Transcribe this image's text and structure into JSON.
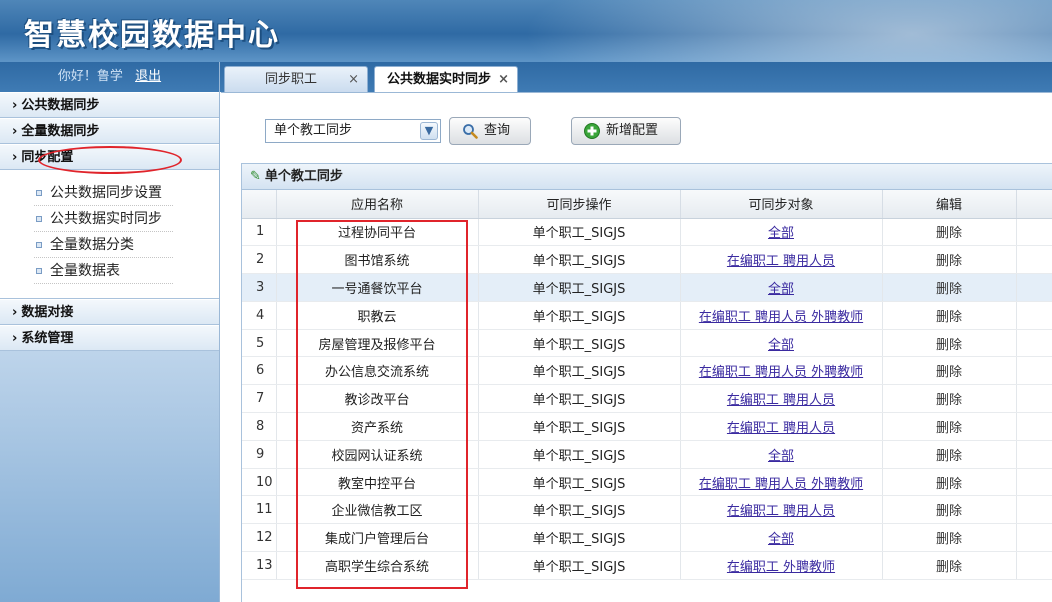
{
  "header": {
    "logo_text": "智慧校园数据中心"
  },
  "user": {
    "greeting": "你好！鲁学",
    "logout": "退出"
  },
  "sidebar": {
    "sections": [
      {
        "label": "公共数据同步"
      },
      {
        "label": "全量数据同步"
      },
      {
        "label": "同步配置"
      },
      {
        "label": "数据对接"
      },
      {
        "label": "系统管理"
      }
    ],
    "sub_items": [
      {
        "label": "公共数据同步设置"
      },
      {
        "label": "公共数据实时同步"
      },
      {
        "label": "全量数据分类"
      },
      {
        "label": "全量数据表"
      }
    ]
  },
  "tabs": [
    {
      "label": "同步职工",
      "close": "×"
    },
    {
      "label": "公共数据实时同步",
      "close": "×"
    }
  ],
  "toolbar": {
    "select_value": "单个教工同步",
    "query_label": "查询",
    "add_label": "新增配置"
  },
  "panel": {
    "title": "单个教工同步"
  },
  "table": {
    "columns": [
      "应用名称",
      "可同步操作",
      "可同步对象",
      "编辑"
    ],
    "rows": [
      {
        "no": "1",
        "app": "过程协同平台",
        "op": "单个职工_SIGJS",
        "targets": "全部",
        "edit": "删除"
      },
      {
        "no": "2",
        "app": "图书馆系统",
        "op": "单个职工_SIGJS",
        "targets": "在编职工 聘用人员",
        "edit": "删除"
      },
      {
        "no": "3",
        "app": "一号通餐饮平台",
        "op": "单个职工_SIGJS",
        "targets": "全部",
        "edit": "删除"
      },
      {
        "no": "4",
        "app": "职教云",
        "op": "单个职工_SIGJS",
        "targets": "在编职工 聘用人员 外聘教师",
        "edit": "删除"
      },
      {
        "no": "5",
        "app": "房屋管理及报修平台",
        "op": "单个职工_SIGJS",
        "targets": "全部",
        "edit": "删除"
      },
      {
        "no": "6",
        "app": "办公信息交流系统",
        "op": "单个职工_SIGJS",
        "targets": "在编职工 聘用人员 外聘教师",
        "edit": "删除"
      },
      {
        "no": "7",
        "app": "教诊改平台",
        "op": "单个职工_SIGJS",
        "targets": "在编职工 聘用人员",
        "edit": "删除"
      },
      {
        "no": "8",
        "app": "资产系统",
        "op": "单个职工_SIGJS",
        "targets": "在编职工 聘用人员",
        "edit": "删除"
      },
      {
        "no": "9",
        "app": "校园网认证系统",
        "op": "单个职工_SIGJS",
        "targets": "全部",
        "edit": "删除"
      },
      {
        "no": "10",
        "app": "教室中控平台",
        "op": "单个职工_SIGJS",
        "targets": "在编职工 聘用人员 外聘教师",
        "edit": "删除"
      },
      {
        "no": "11",
        "app": "企业微信教工区",
        "op": "单个职工_SIGJS",
        "targets": "在编职工 聘用人员",
        "edit": "删除"
      },
      {
        "no": "12",
        "app": "集成门户管理后台",
        "op": "单个职工_SIGJS",
        "targets": "全部",
        "edit": "删除"
      },
      {
        "no": "13",
        "app": "高职学生综合系统",
        "op": "单个职工_SIGJS",
        "targets": "在编职工 外聘教师",
        "edit": "删除"
      }
    ]
  },
  "colors": {
    "highlight_red": "#e0242b",
    "link": "#3a2aa0",
    "selected_row": "#e4eef8"
  }
}
